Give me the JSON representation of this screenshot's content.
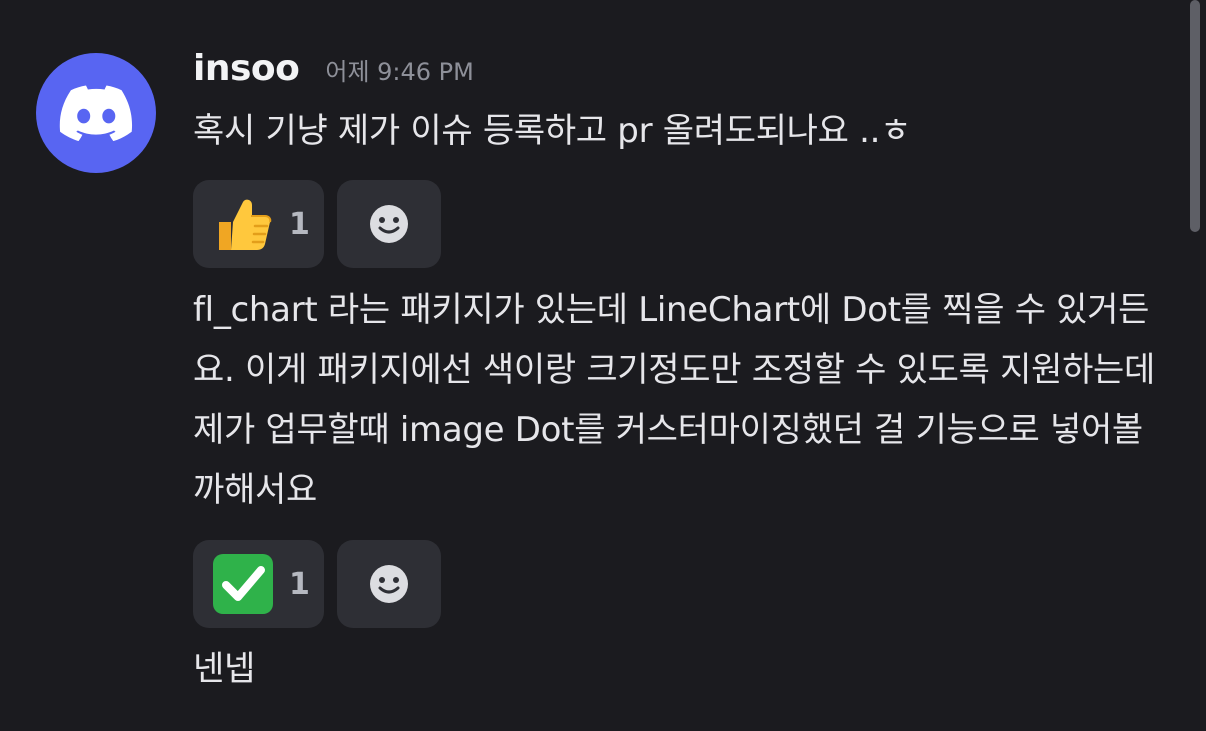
{
  "message": {
    "author": "insoo",
    "timestamp": "어제 9:46 PM",
    "avatar_icon": "discord-logo-icon",
    "avatar_color": "#5865f2",
    "lines": [
      {
        "text": "혹시 기냥 제가 이슈 등록하고 pr 올려도되나요 ..ㅎ",
        "reactions": [
          {
            "emoji": "thumbs-up-icon",
            "count": "1"
          },
          {
            "emoji": "add-reaction-icon"
          }
        ]
      },
      {
        "text": "fl_chart 라는 패키지가 있는데 LineChart에 Dot를 찍을 수 있거든요. 이게 패키지에선 색이랑 크기정도만 조정할 수 있도록 지원하는데 제가 업무할때 image Dot를 커스터마이징했던 걸 기능으로 넣어볼까해서요",
        "reactions": [
          {
            "emoji": "check-mark-icon",
            "count": "1"
          },
          {
            "emoji": "add-reaction-icon"
          }
        ]
      },
      {
        "text": "넨넵"
      }
    ]
  },
  "colors": {
    "background": "#1b1b1f",
    "reaction_bg": "#2e2f35",
    "text": "#e6e6ea",
    "muted": "#8e9099",
    "blurple": "#5865f2",
    "check_green": "#2fb24a"
  }
}
